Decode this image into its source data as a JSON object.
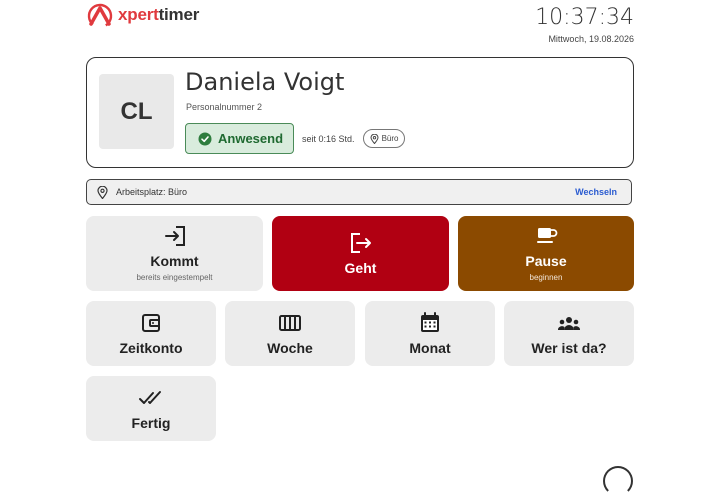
{
  "app": {
    "logo_prefix": "xpert",
    "logo_suffix": "timer"
  },
  "clock": {
    "time": "10:37:34",
    "date": "Mittwoch, 19.08.2026"
  },
  "profile": {
    "initials": "CL",
    "name": "Daniela Voigt",
    "personnel_number": "Personalnummer 2",
    "status": "Anwesend",
    "since": "seit 0:16 Std.",
    "location": "Büro"
  },
  "workplace": {
    "label": "Arbeitsplatz: Büro",
    "action": "Wechseln"
  },
  "actions": {
    "kommt": {
      "label": "Kommt",
      "sub": "bereits eingestempelt"
    },
    "geht": {
      "label": "Geht"
    },
    "pause": {
      "label": "Pause",
      "sub": "beginnen"
    }
  },
  "tiles": {
    "zeitkonto": "Zeitkonto",
    "woche": "Woche",
    "monat": "Monat",
    "wer": "Wer ist da?",
    "fertig": "Fertig"
  },
  "colors": {
    "accent": "#e03a3e",
    "geht": "#b10012",
    "pause": "#8b4a00",
    "present": "#1f6a31",
    "link": "#2a5bd0"
  },
  "icons": {
    "logo": "logo-icon",
    "status": "check-circle-icon",
    "location": "map-pin-icon",
    "kommt": "login-icon",
    "geht": "logout-icon",
    "pause": "coffee-cup-icon",
    "zeitkonto": "wallet-icon",
    "woche": "week-columns-icon",
    "monat": "calendar-icon",
    "wer": "people-group-icon",
    "fertig": "double-check-icon"
  }
}
